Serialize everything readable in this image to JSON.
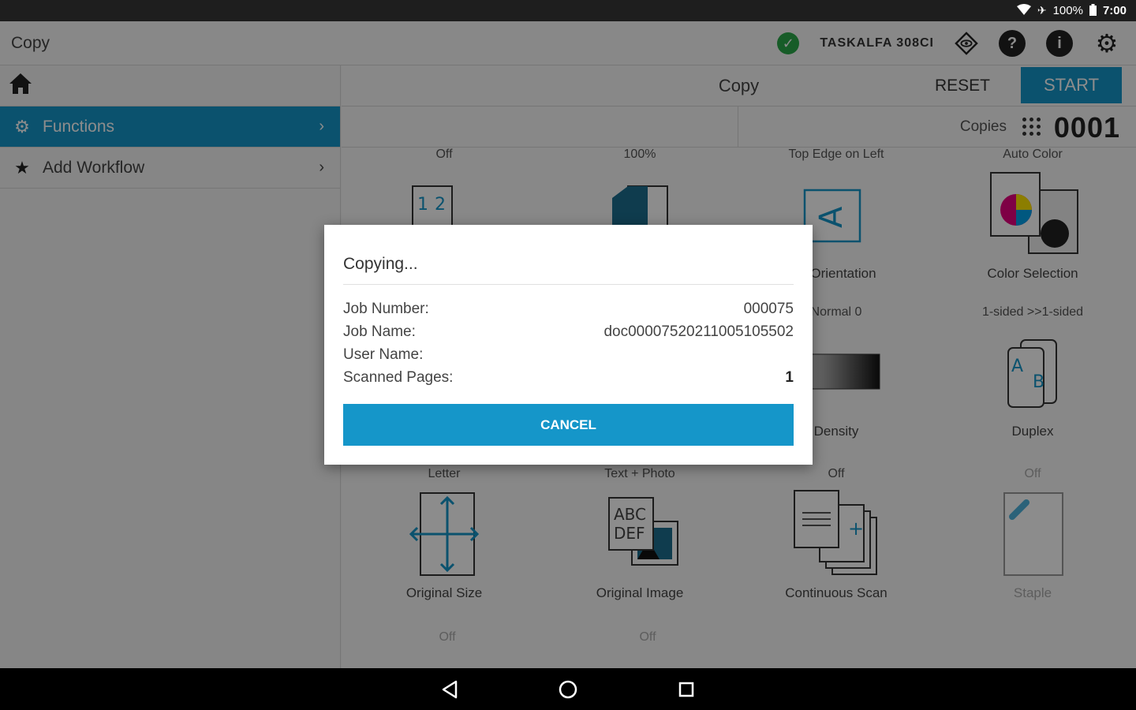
{
  "status_bar": {
    "battery": "100%",
    "time": "7:00"
  },
  "app_bar": {
    "title": "Copy",
    "device_name": "TASKALFA 308CI"
  },
  "sidebar": {
    "items": [
      {
        "label": "Functions",
        "icon": "gear-cluster-icon",
        "active": true
      },
      {
        "label": "Add Workflow",
        "icon": "star-icon",
        "active": false
      }
    ]
  },
  "action_bar": {
    "title": "Copy",
    "reset_label": "RESET",
    "start_label": "START"
  },
  "copies": {
    "label": "Copies",
    "value": "0001"
  },
  "tiles": [
    {
      "value": "Off",
      "name": ""
    },
    {
      "value": "100%",
      "name": ""
    },
    {
      "value": "Top Edge on Left",
      "name": "al Orientation"
    },
    {
      "value": "Auto Color",
      "name": "Color Selection"
    },
    {
      "value": "",
      "name": ""
    },
    {
      "value": "",
      "name": ""
    },
    {
      "value": "Normal 0",
      "name": "Density"
    },
    {
      "value": "1-sided >>1-sided",
      "name": "Duplex"
    },
    {
      "value": "Letter",
      "name": "Original Size"
    },
    {
      "value": "Text + Photo",
      "name": "Original Image"
    },
    {
      "value": "Off",
      "name": "Continuous Scan"
    },
    {
      "value": "Off",
      "name": "Staple"
    },
    {
      "value": "Off",
      "name": ""
    },
    {
      "value": "Off",
      "name": ""
    }
  ],
  "dialog": {
    "title": "Copying...",
    "rows": [
      {
        "label": "Job Number:",
        "value": "000075"
      },
      {
        "label": "Job Name:",
        "value": "doc00007520211005105502"
      },
      {
        "label": "User Name:",
        "value": ""
      },
      {
        "label": "Scanned Pages:",
        "value": "1"
      }
    ],
    "cancel_label": "CANCEL"
  },
  "colors": {
    "accent": "#1596c9",
    "ok": "#2aa84a"
  }
}
